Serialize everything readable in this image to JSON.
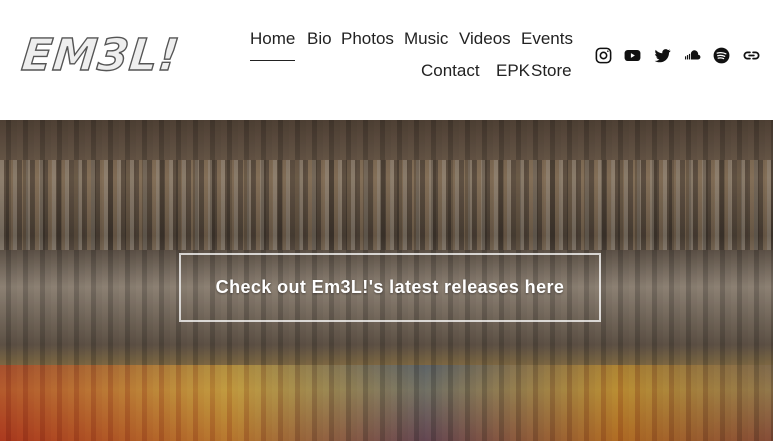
{
  "site": {
    "logo_text": "EM3L!"
  },
  "nav": {
    "items": [
      {
        "label": "Home",
        "active": true
      },
      {
        "label": "Bio"
      },
      {
        "label": "Photos"
      },
      {
        "label": "Music"
      },
      {
        "label": "Videos"
      },
      {
        "label": "Events"
      },
      {
        "label": "Contact"
      },
      {
        "label": "EPK"
      },
      {
        "label": "Store"
      }
    ]
  },
  "social": [
    "instagram-icon",
    "youtube-icon",
    "twitter-icon",
    "soundcloud-icon",
    "spotify-icon",
    "link-icon"
  ],
  "hero": {
    "cta_label": "Check out Em3L!'s latest releases here"
  }
}
